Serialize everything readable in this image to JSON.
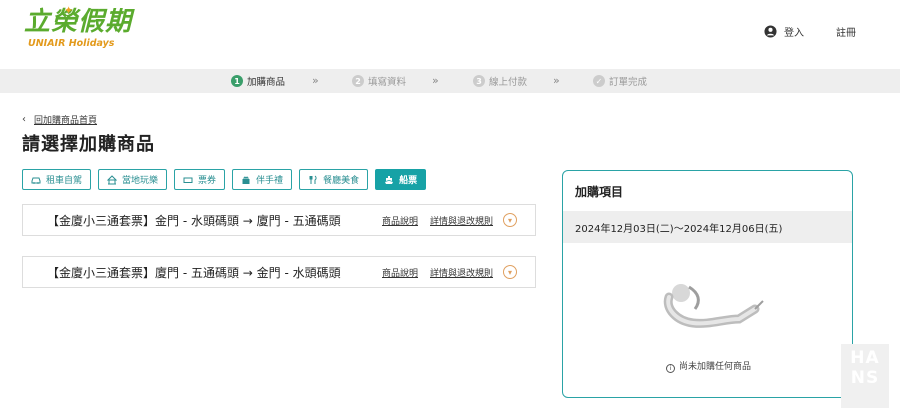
{
  "header": {
    "logo_cn": "立榮假期",
    "logo_en": "UNIAIR Holidays",
    "login_label": "登入",
    "register_label": "註冊"
  },
  "steps": [
    {
      "num": "1",
      "label": "加購商品",
      "state": "active"
    },
    {
      "num": "2",
      "label": "填寫資料",
      "state": "pending"
    },
    {
      "num": "3",
      "label": "線上付款",
      "state": "pending"
    },
    {
      "num": "✓",
      "label": "訂單完成",
      "state": "pending"
    }
  ],
  "step_separator": "»",
  "nav": {
    "back_label": "回加購商品首頁",
    "page_title": "請選擇加購商品"
  },
  "filters": [
    {
      "label": "租車自駕",
      "icon": "car-icon",
      "active": false
    },
    {
      "label": "當地玩樂",
      "icon": "attraction-icon",
      "active": false
    },
    {
      "label": "票券",
      "icon": "ticket-icon",
      "active": false
    },
    {
      "label": "伴手禮",
      "icon": "gift-icon",
      "active": false
    },
    {
      "label": "餐廳美食",
      "icon": "dining-icon",
      "active": false
    },
    {
      "label": "船票",
      "icon": "ship-icon",
      "active": true
    }
  ],
  "products": [
    {
      "name": "【金廈小三通套票】金門 - 水頭碼頭 → 廈門 - 五通碼頭",
      "desc_link": "商品說明",
      "rules_link": "詳情與退改規則"
    },
    {
      "name": "【金廈小三通套票】廈門 - 五通碼頭 → 金門 - 水頭碼頭",
      "desc_link": "商品說明",
      "rules_link": "詳情與退改規則"
    }
  ],
  "cart": {
    "title": "加購項目",
    "date_range": "2024年12月03日(二)～2024年12月06日(五)",
    "empty_message": "尚未加購任何商品"
  },
  "watermark": {
    "line1": "HA",
    "line2": "NS"
  },
  "colors": {
    "brand_green": "#5bab2e",
    "brand_orange": "#e39a1c",
    "accent_teal": "#17a2a6",
    "step_active": "#3a9e6a"
  }
}
